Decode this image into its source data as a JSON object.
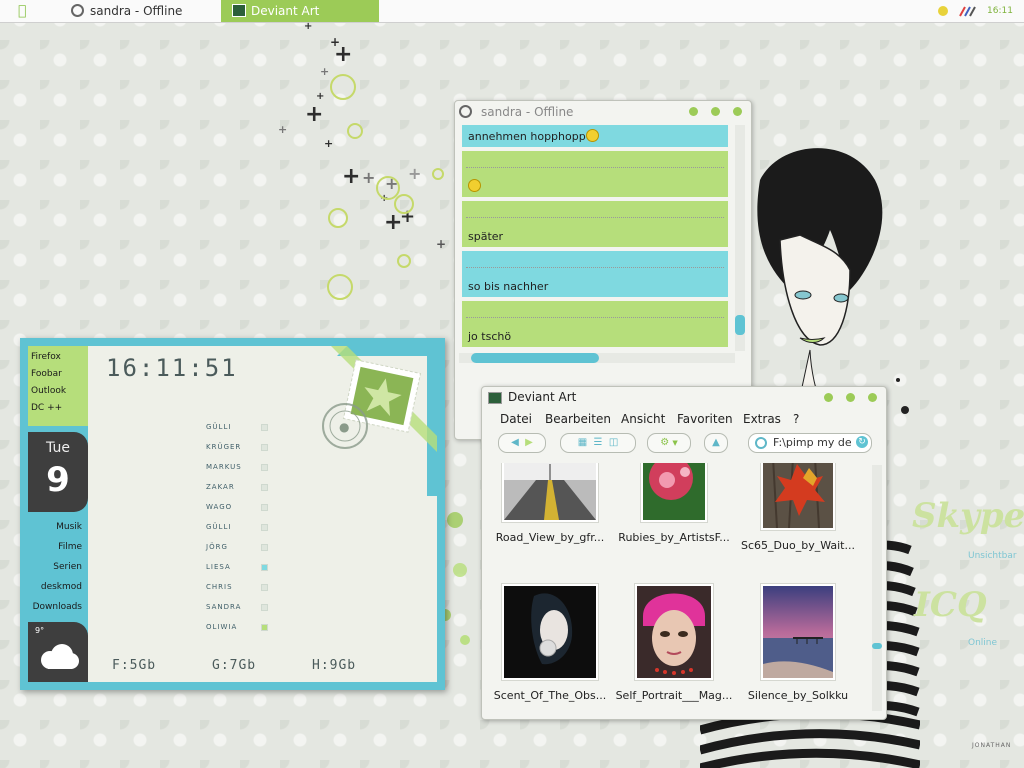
{
  "taskbar": {
    "tasks": [
      {
        "label": "sandra - Offline"
      },
      {
        "label": "Deviant Art"
      }
    ],
    "clock": "16:11"
  },
  "widgets": {
    "skype": {
      "brand": "Skype",
      "status": "Unsichtbar"
    },
    "icq": {
      "brand": "ICQ",
      "status": "Online"
    }
  },
  "dock": {
    "apps": [
      "Firefox",
      "Foobar",
      "Outlook",
      "DC ++"
    ],
    "day_name": "Tue",
    "day_number": "9",
    "links": [
      "Musik",
      "Filme",
      "Serien",
      "deskmod",
      "Downloads"
    ],
    "temperature": "9°",
    "clock": "16:11:51",
    "contacts": [
      "GÜLLI",
      "KRÜGER",
      "MARKUS",
      "ZAKAR",
      "WAGO",
      "GÜLLI",
      "JÖRG",
      "LIESA",
      "CHRIS",
      "SANDRA",
      "OLIWIA"
    ],
    "drives": [
      "F:5Gb",
      "G:7Gb",
      "H:9Gb"
    ]
  },
  "chat": {
    "title": "sandra - Offline",
    "messages": [
      {
        "text": "annehmen hopphopp",
        "emoji": true
      },
      {
        "text": "",
        "emoji": true
      },
      {
        "text": "später",
        "emoji": false
      },
      {
        "text": "so bis nachher",
        "emoji": false
      },
      {
        "text": "jo tschö",
        "emoji": false
      }
    ]
  },
  "explorer": {
    "title": "Deviant Art",
    "menu": [
      "Datei",
      "Bearbeiten",
      "Ansicht",
      "Favoriten",
      "Extras",
      "?"
    ],
    "search_value": "F:\\pimp my de",
    "files": [
      {
        "name": "Road_View_by_gfr..."
      },
      {
        "name": "Rubies_by_ArtistsF..."
      },
      {
        "name": "Sc65_Duo_by_Wait..."
      },
      {
        "name": "Scent_Of_The_Obs..."
      },
      {
        "name": "Self_Portrait___Mag..."
      },
      {
        "name": "Silence_by_Solkku"
      }
    ]
  },
  "colors": {
    "accent_green": "#9ccb57",
    "accent_cyan": "#5fc3d3",
    "bubble_green": "#b6de7b",
    "bubble_cyan": "#7fd9e0"
  },
  "watermark": "JONATHAN"
}
